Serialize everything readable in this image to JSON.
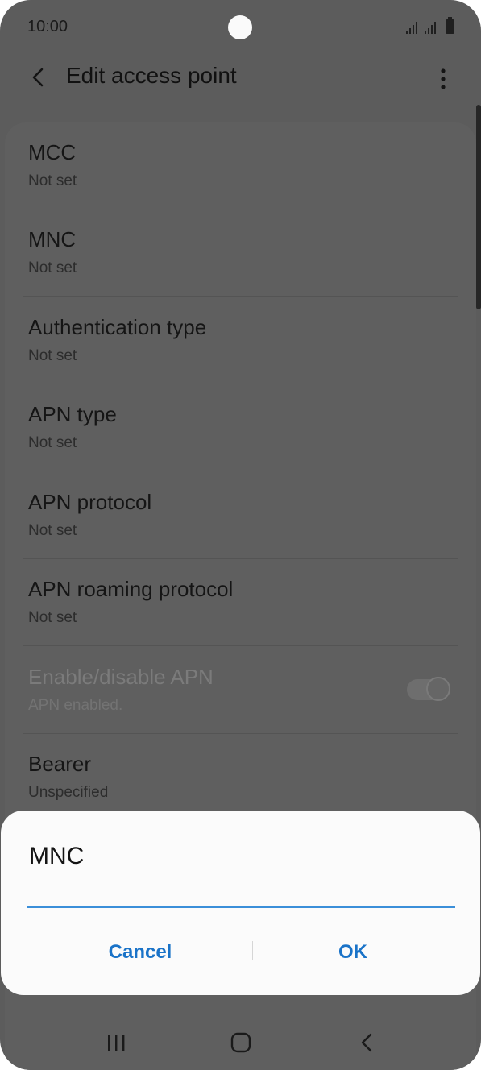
{
  "status_bar": {
    "time": "10:00"
  },
  "app_bar": {
    "title": "Edit access point"
  },
  "settings": [
    {
      "title": "MCC",
      "summary": "Not set"
    },
    {
      "title": "MNC",
      "summary": "Not set"
    },
    {
      "title": "Authentication type",
      "summary": "Not set"
    },
    {
      "title": "APN type",
      "summary": "Not set"
    },
    {
      "title": "APN protocol",
      "summary": "Not set"
    },
    {
      "title": "APN roaming protocol",
      "summary": "Not set"
    },
    {
      "title": "Enable/disable APN",
      "summary": "APN enabled.",
      "toggle_on": true
    },
    {
      "title": "Bearer",
      "summary": "Unspecified"
    }
  ],
  "dialog": {
    "title": "MNC",
    "input_value": "",
    "cancel_label": "Cancel",
    "ok_label": "OK"
  },
  "colors": {
    "accent": "#1a73c8",
    "input_underline": "#3b8fd9",
    "dim_background": "#5c5c5c",
    "dialog_background": "#fbfbfb"
  },
  "icons": {
    "back": "chevron-left-icon",
    "more": "more-vert-icon",
    "nav_recents": "recents-icon",
    "nav_home": "home-icon",
    "nav_back": "back-icon"
  }
}
